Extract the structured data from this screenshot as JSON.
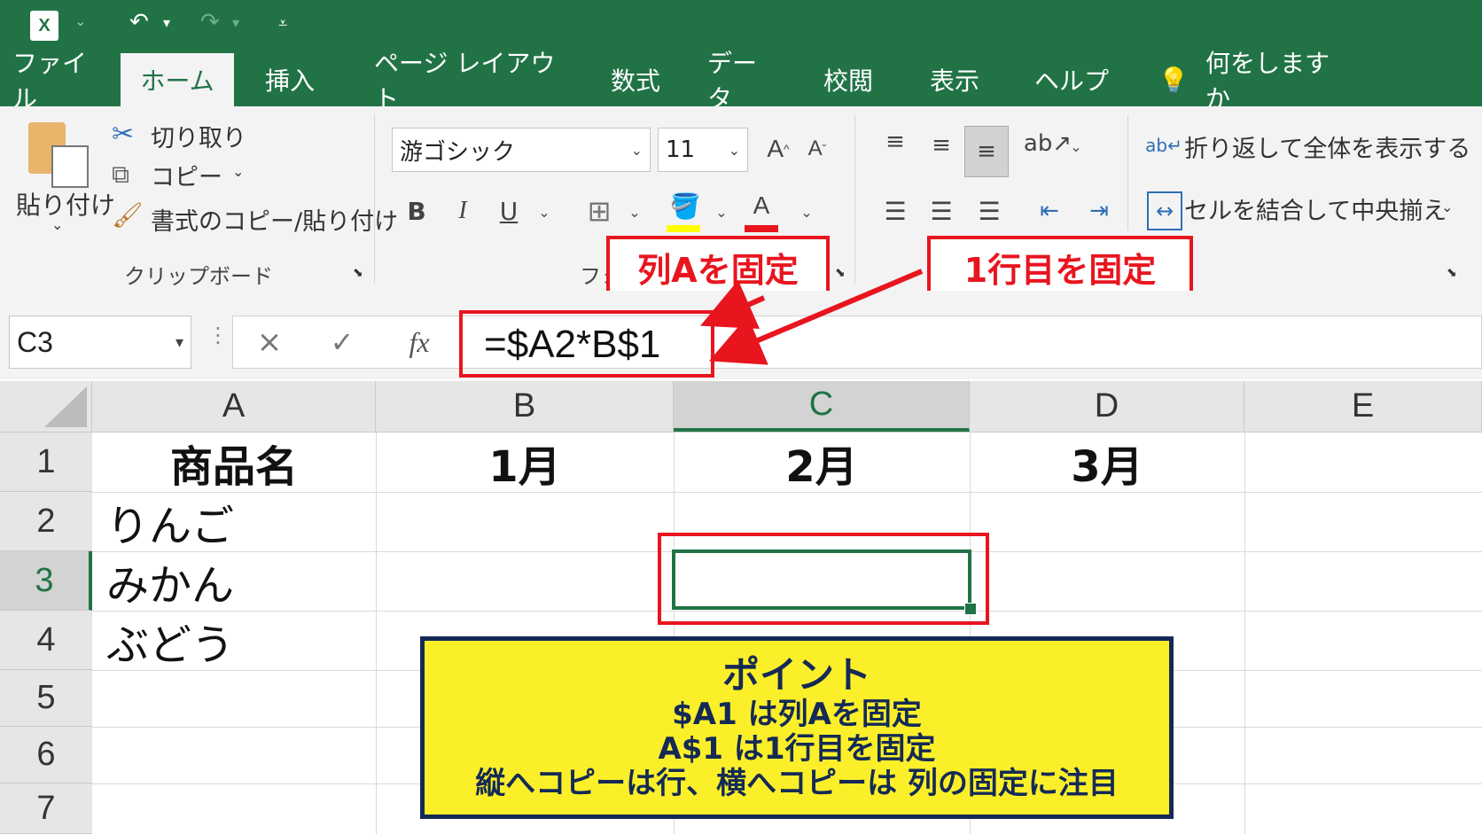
{
  "app": {
    "quick_access": {
      "undo": "↶",
      "redo": "↷"
    }
  },
  "tabs": [
    "ファイル",
    "ホーム",
    "挿入",
    "ページ レイアウト",
    "数式",
    "データ",
    "校閲",
    "表示",
    "ヘルプ"
  ],
  "tell_me": "何をしますか",
  "clipboard": {
    "paste": "貼り付け",
    "cut": "切り取り",
    "copy": "コピー",
    "format_painter": "書式のコピー/貼り付け",
    "group_label": "クリップボード"
  },
  "font": {
    "name": "游ゴシック",
    "size": "11",
    "bold": "B",
    "italic": "I",
    "underline": "U",
    "color_letter": "A",
    "group_label_partial": "フォ"
  },
  "alignment": {
    "wrap_text": "折り返して全体を表示する",
    "merge_center": "セルを結合して中央揃え"
  },
  "formula_bar": {
    "name_box": "C3",
    "cancel": "×",
    "enter": "✓",
    "fx": "fx",
    "formula": "=$A2*B$1"
  },
  "callouts": {
    "col_fixed": "列Aを固定",
    "row_fixed": "1行目を固定"
  },
  "columns": [
    "A",
    "B",
    "C",
    "D",
    "E"
  ],
  "rows": [
    "1",
    "2",
    "3",
    "4",
    "5",
    "6",
    "7"
  ],
  "cells": {
    "A1": "商品名",
    "B1": "1月",
    "C1": "2月",
    "D1": "3月",
    "A2": "りんご",
    "A3": "みかん",
    "A4": "ぶどう"
  },
  "point_box": {
    "title": "ポイント",
    "line1": "$A1 は列Aを固定",
    "line2": "A$1 は1行目を固定",
    "line3": "縦へコピーは行、横へコピーは 列の固定に注目"
  },
  "colors": {
    "excel_green": "#217346",
    "highlight_red": "#e8151f",
    "point_yellow": "#fbef2a",
    "point_border": "#142a55"
  }
}
